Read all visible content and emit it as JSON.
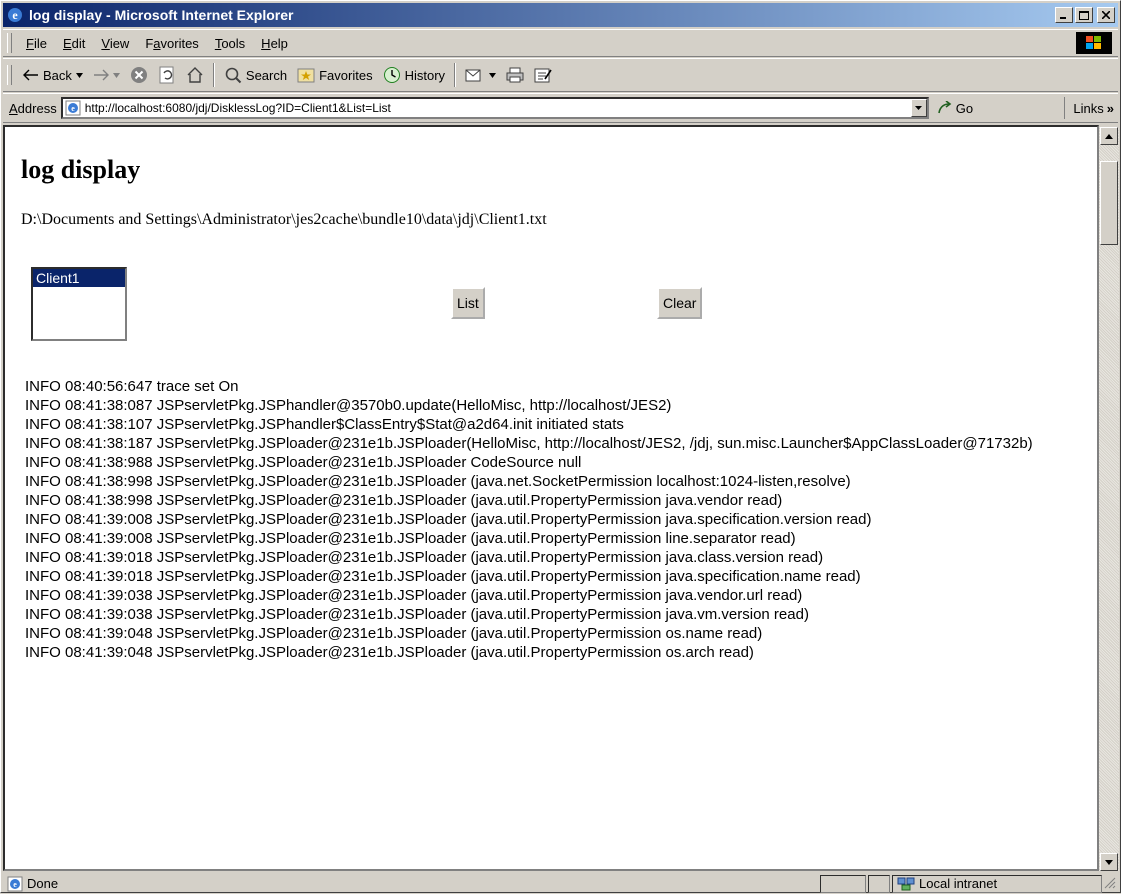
{
  "window": {
    "title": "log display - Microsoft Internet Explorer"
  },
  "menu": {
    "items": [
      {
        "label": "File",
        "accel": "F",
        "rest": "ile"
      },
      {
        "label": "Edit",
        "accel": "E",
        "rest": "dit"
      },
      {
        "label": "View",
        "accel": "V",
        "rest": "iew"
      },
      {
        "label": "Favorites",
        "accel": "a",
        "pre": "F",
        "rest": "vorites"
      },
      {
        "label": "Tools",
        "accel": "T",
        "rest": "ools"
      },
      {
        "label": "Help",
        "accel": "H",
        "rest": "elp"
      }
    ]
  },
  "toolbar": {
    "back": "Back",
    "search": "Search",
    "favorites": "Favorites",
    "history": "History"
  },
  "address": {
    "label_pre": "A",
    "label_rest": "ddress",
    "url": "http://localhost:6080/jdj/DisklessLog?ID=Client1&List=List",
    "go": "Go",
    "links": "Links"
  },
  "page": {
    "heading": "log display",
    "path": "D:\\Documents and Settings\\Administrator\\jes2cache\\bundle10\\data\\jdj\\Client1.txt",
    "listbox_selected": "Client1",
    "list_button": "List",
    "clear_button": "Clear",
    "log_lines": [
      "INFO 08:40:56:647 trace set On",
      "INFO 08:41:38:087 JSPservletPkg.JSPhandler@3570b0.update(HelloMisc, http://localhost/JES2)",
      "INFO 08:41:38:107 JSPservletPkg.JSPhandler$ClassEntry$Stat@a2d64.init initiated stats",
      "INFO 08:41:38:187 JSPservletPkg.JSPloader@231e1b.JSPloader(HelloMisc, http://localhost/JES2, /jdj, sun.misc.Launcher$AppClassLoader@71732b)",
      "INFO 08:41:38:988 JSPservletPkg.JSPloader@231e1b.JSPloader CodeSource null",
      "INFO 08:41:38:998 JSPservletPkg.JSPloader@231e1b.JSPloader (java.net.SocketPermission localhost:1024-listen,resolve)",
      "INFO 08:41:38:998 JSPservletPkg.JSPloader@231e1b.JSPloader (java.util.PropertyPermission java.vendor read)",
      "INFO 08:41:39:008 JSPservletPkg.JSPloader@231e1b.JSPloader (java.util.PropertyPermission java.specification.version read)",
      "INFO 08:41:39:008 JSPservletPkg.JSPloader@231e1b.JSPloader (java.util.PropertyPermission line.separator read)",
      "INFO 08:41:39:018 JSPservletPkg.JSPloader@231e1b.JSPloader (java.util.PropertyPermission java.class.version read)",
      "INFO 08:41:39:018 JSPservletPkg.JSPloader@231e1b.JSPloader (java.util.PropertyPermission java.specification.name read)",
      "INFO 08:41:39:038 JSPservletPkg.JSPloader@231e1b.JSPloader (java.util.PropertyPermission java.vendor.url read)",
      "INFO 08:41:39:038 JSPservletPkg.JSPloader@231e1b.JSPloader (java.util.PropertyPermission java.vm.version read)",
      "INFO 08:41:39:048 JSPservletPkg.JSPloader@231e1b.JSPloader (java.util.PropertyPermission os.name read)",
      "INFO 08:41:39:048 JSPservletPkg.JSPloader@231e1b.JSPloader (java.util.PropertyPermission os.arch read)"
    ]
  },
  "status": {
    "text": "Done",
    "zone": "Local intranet"
  }
}
